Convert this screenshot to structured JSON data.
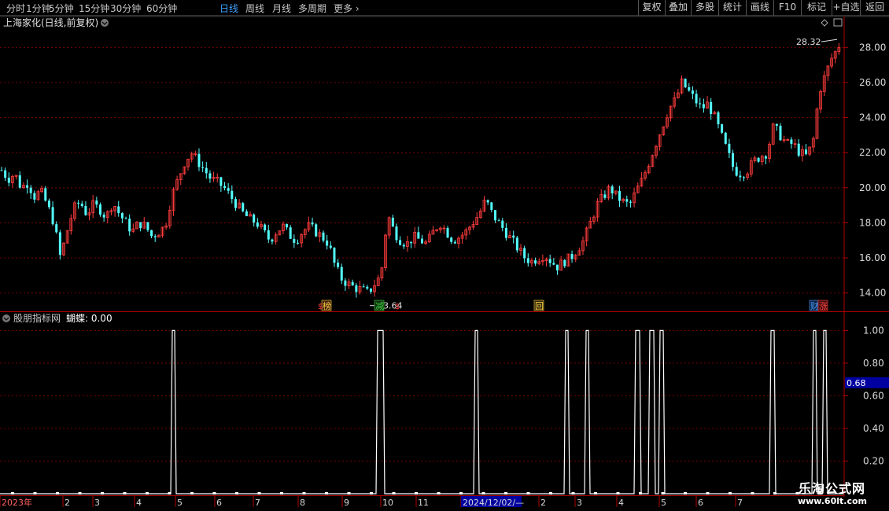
{
  "toolbar": {
    "periods": [
      {
        "label": "分时",
        "active": false
      },
      {
        "label": "1分钟",
        "active": false
      },
      {
        "label": "5分钟",
        "active": false
      },
      {
        "label": "15分钟",
        "active": false
      },
      {
        "label": "30分钟",
        "active": false
      },
      {
        "label": "60分钟",
        "active": false
      },
      {
        "label": "日线",
        "active": true
      },
      {
        "label": "周线",
        "active": false
      },
      {
        "label": "月线",
        "active": false
      },
      {
        "label": "多周期",
        "active": false
      },
      {
        "label": "更多",
        "active": false
      }
    ],
    "right_buttons": [
      "复权",
      "叠加",
      "多股",
      "统计",
      "画线",
      "F10",
      "标记",
      "+自选",
      "返回"
    ]
  },
  "main_panel": {
    "title": "上海家化(日线,前复权)",
    "high_label": "28.32",
    "low_label": "13.64",
    "price_axis": [
      "28.00",
      "26.00",
      "24.00",
      "22.00",
      "20.00",
      "18.00",
      "16.00",
      "14.00"
    ],
    "markers": [
      {
        "text": "榜",
        "color": "#ffd040"
      },
      {
        "text": "减",
        "color": "#40d040"
      },
      {
        "text": "回",
        "color": "#ffd040"
      },
      {
        "text": "财",
        "color": "#40a0ff"
      },
      {
        "text": "涨",
        "color": "#ff4040"
      }
    ]
  },
  "indicator_panel": {
    "title": "股朋指标网",
    "value_label": "蝴蝶: 0.00",
    "axis": [
      "1.00",
      "0.80",
      "0.60",
      "0.40",
      "0.20"
    ],
    "cursor_value": "0.68"
  },
  "date_axis": [
    "2023年",
    "2",
    "3",
    "4",
    "5",
    "6",
    "7",
    "8",
    "9",
    "10",
    "11",
    "2024/12/02/—",
    "2",
    "3",
    "4",
    "5",
    "6",
    "7"
  ],
  "watermark": {
    "line1": "乐淘公式网",
    "line2": "www.60lt.com"
  },
  "colors": {
    "up": "#ff3c3c",
    "down": "#54ffff",
    "grid": "#7a0000",
    "axis_line": "#b00000",
    "axis_text": "#d8d8d8",
    "active_tab": "#40a0ff"
  },
  "chart_data": {
    "type": "candlestick",
    "price_axis_range": [
      13.0,
      29.0
    ],
    "indicator_axis_range": [
      0,
      1.05
    ],
    "price_path": [
      21.0,
      20.5,
      20.8,
      20.0,
      20.3,
      19.5,
      19.8,
      19.0,
      18.0,
      16.0,
      17.5,
      18.8,
      19.2,
      18.5,
      19.0,
      18.8,
      18.3,
      19.2,
      18.5,
      18.0,
      17.5,
      18.0,
      17.8,
      17.2,
      17.5,
      17.8,
      19.5,
      20.5,
      21.5,
      22.0,
      21.5,
      21.0,
      20.5,
      20.3,
      20.0,
      19.5,
      19.0,
      18.5,
      18.2,
      18.0,
      17.5,
      17.0,
      17.5,
      17.8,
      17.3,
      17.0,
      17.5,
      17.8,
      17.5,
      17.2,
      16.8,
      15.5,
      14.8,
      14.5,
      14.3,
      14.2,
      14.0,
      14.5,
      15.0,
      18.5,
      17.5,
      17.0,
      16.8,
      17.2,
      17.0,
      16.8,
      17.5,
      18.0,
      17.5,
      17.0,
      17.2,
      17.5,
      18.0,
      18.5,
      19.3,
      18.5,
      18.0,
      17.5,
      17.0,
      16.5,
      16.0,
      15.8,
      16.0,
      16.2,
      15.8,
      15.5,
      15.8,
      16.0,
      16.5,
      17.0,
      18.0,
      19.0,
      19.5,
      20.0,
      19.5,
      19.2,
      19.0,
      19.8,
      20.5,
      21.5,
      22.5,
      23.5,
      24.5,
      25.0,
      26.0,
      25.5,
      25.0,
      24.5,
      24.8,
      24.0,
      23.0,
      22.0,
      21.0,
      20.8,
      21.0,
      21.5,
      21.8,
      22.0,
      23.5,
      23.0,
      22.5,
      22.5,
      22.0,
      21.8,
      22.5,
      25.5,
      26.5,
      27.5,
      28.0
    ],
    "low_point": 13.64,
    "high_point": 28.32,
    "indicator_series": {
      "name": "蝴蝶",
      "baseline": 0,
      "peak": 1.0,
      "last_value": 0.0
    }
  }
}
